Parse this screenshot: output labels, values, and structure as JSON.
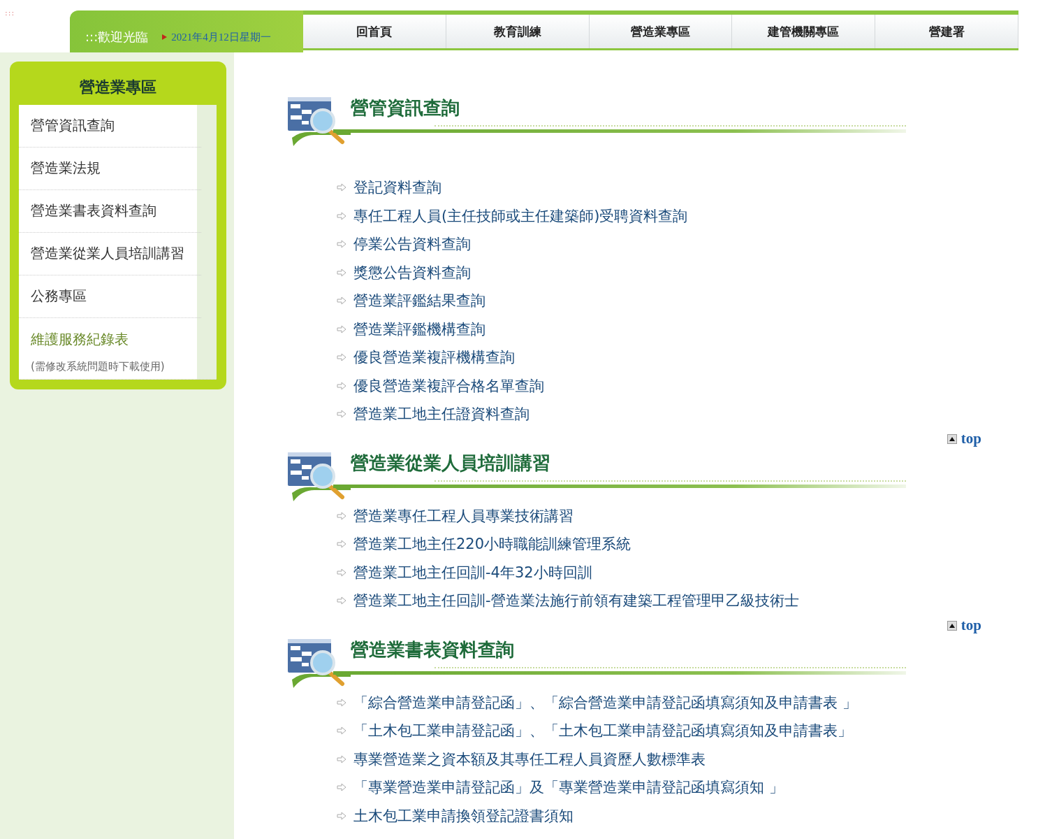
{
  "skip_link": ":::",
  "header": {
    "welcome": ":::歡迎光臨",
    "date": "2021年4月12日星期一"
  },
  "nav": [
    {
      "label": "回首頁"
    },
    {
      "label": "教育訓練"
    },
    {
      "label": "營造業專區"
    },
    {
      "label": "建管機關專區"
    },
    {
      "label": "營建署"
    }
  ],
  "sidebar": {
    "title": "營造業專區",
    "items": [
      {
        "kind": "page",
        "label": "營管資訊查詢"
      },
      {
        "kind": "page",
        "label": "營造業法規"
      },
      {
        "kind": "page",
        "label": "營造業書表資料查詢"
      },
      {
        "kind": "page",
        "label": "營造業從業人員培訓講習"
      },
      {
        "kind": "page",
        "label": "公務專區"
      },
      {
        "kind": "download",
        "label": "維護服務紀錄表",
        "note": "(需修改系統問題時下載使用)"
      }
    ]
  },
  "sections": [
    {
      "title": "營管資訊查詢",
      "items": [
        "登記資料查詢",
        "專任工程人員(主任技師或主任建築師)受聘資料查詢",
        "停業公告資料查詢",
        "獎懲公告資料查詢",
        "營造業評鑑結果查詢",
        "營造業評鑑機構查詢",
        "優良營造業複評機構查詢",
        "優良營造業複評合格名單查詢",
        "營造業工地主任證資料查詢"
      ],
      "top_link": "top"
    },
    {
      "title": "營造業從業人員培訓講習",
      "items": [
        "營造業專任工程人員專業技術講習",
        "營造業工地主任220小時職能訓練管理系統",
        "營造業工地主任回訓-4年32小時回訓",
        "營造業工地主任回訓-營造業法施行前領有建築工程管理甲乙級技術士"
      ],
      "top_link": "top"
    },
    {
      "title": "營造業書表資料查詢",
      "items": [
        "「綜合營造業申請登記函」、「綜合營造業申請登記函填寫須知及申請書表 」",
        "「土木包工業申請登記函」、「土木包工業申請登記函填寫須知及申請書表」",
        "專業營造業之資本額及其專任工程人員資歷人數標準表",
        "「專業營造業申請登記函」及「專業營造業申請登記函填寫須知 」",
        "土木包工業申請換領登記證書須知"
      ]
    }
  ]
}
